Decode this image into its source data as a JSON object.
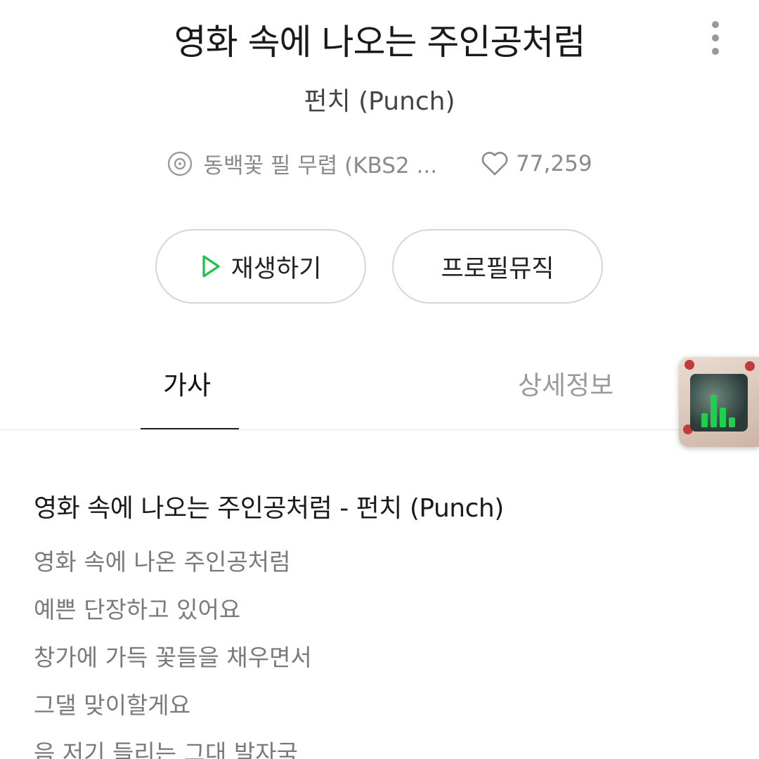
{
  "song": {
    "title": "영화 속에 나오는 주인공처럼",
    "artist": "펀치 (Punch)",
    "album": "동백꽃 필 무렵 (KBS2 ...",
    "likes": "77,259"
  },
  "actions": {
    "play_label": "재생하기",
    "profile_music_label": "프로필뮤직"
  },
  "tabs": [
    {
      "label": "가사",
      "active": true
    },
    {
      "label": "상세정보",
      "active": false
    }
  ],
  "lyrics": {
    "heading": "영화 속에 나오는 주인공처럼 - 펀치 (Punch)",
    "lines": [
      "영화 속에 나온 주인공처럼",
      "예쁜 단장하고 있어요",
      "창가에 가득 꽃들을 채우면서",
      "그댈 맞이할게요",
      "음 저기 들리는 그대 발자국"
    ]
  },
  "icons": {
    "more": "more-vertical-icon",
    "album": "disc-icon",
    "likes": "heart-outline-icon",
    "play": "play-outline-icon",
    "now_playing": "equalizer-icon"
  },
  "colors": {
    "accent": "#1fc24a",
    "text_primary": "#1a1a1a",
    "text_secondary": "#8a8a8a",
    "border": "#d6d6d6"
  }
}
